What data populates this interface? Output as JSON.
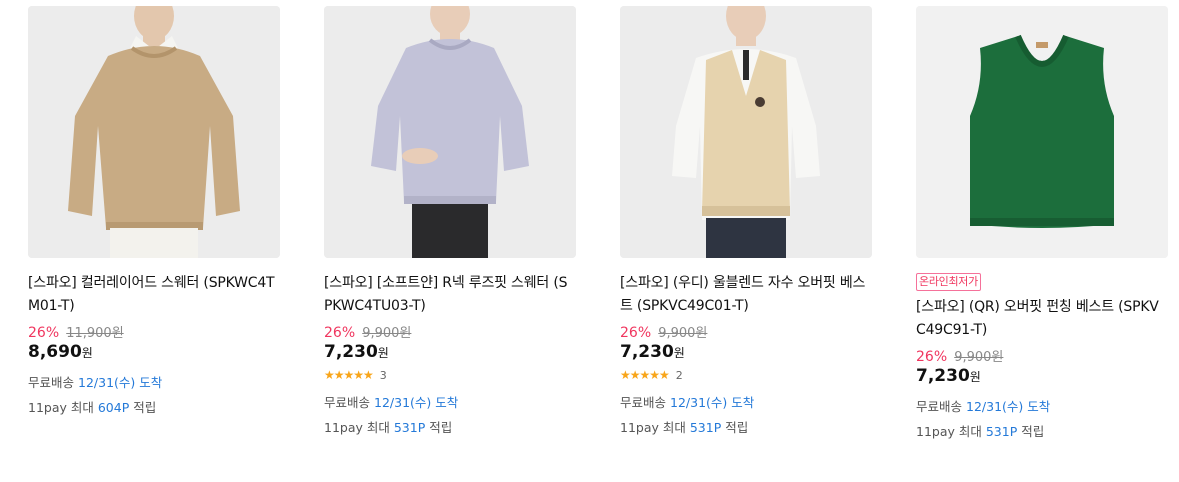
{
  "products": [
    {
      "title": "[스파오] 컬러레이어드 스웨터 (SPKWC4TM01-T)",
      "discount": "26%",
      "original_price": "11,900원",
      "price": "8,690",
      "currency": "원",
      "shipping_label": "무료배송",
      "delivery_date": "12/31(수) 도착",
      "points_prefix": "11pay 최대",
      "points": "604P",
      "points_suffix": "적립"
    },
    {
      "title": "[스파오] [소프트얀] R넥 루즈핏 스웨터 (SPKWC4TU03-T)",
      "discount": "26%",
      "original_price": "9,900원",
      "price": "7,230",
      "currency": "원",
      "stars": "★★★★★",
      "rating": 4.5,
      "review_count": "3",
      "shipping_label": "무료배송",
      "delivery_date": "12/31(수) 도착",
      "points_prefix": "11pay 최대",
      "points": "531P",
      "points_suffix": "적립"
    },
    {
      "title": "[스파오] (우디) 울블렌드 자수 오버핏 베스트 (SPKVC49C01-T)",
      "discount": "26%",
      "original_price": "9,900원",
      "price": "7,230",
      "currency": "원",
      "stars": "★★★★★",
      "rating": 5,
      "review_count": "2",
      "shipping_label": "무료배송",
      "delivery_date": "12/31(수) 도착",
      "points_prefix": "11pay 최대",
      "points": "531P",
      "points_suffix": "적립"
    },
    {
      "badge": "온라인최저가",
      "title": "[스파오] (QR) 오버핏 펀칭 베스트 (SPKVC49C91-T)",
      "discount": "26%",
      "original_price": "9,900원",
      "price": "7,230",
      "currency": "원",
      "shipping_label": "무료배송",
      "delivery_date": "12/31(수) 도착",
      "points_prefix": "11pay 최대",
      "points": "531P",
      "points_suffix": "적립"
    }
  ],
  "colors": {
    "discount": "#f0365f",
    "link_blue": "#2479d8",
    "star": "#f8a51a",
    "sweater_beige": "#c8ab84",
    "sweater_lavender": "#c2c2d8",
    "vest_cream": "#e6d3ae",
    "vest_green": "#1c6e3c"
  }
}
